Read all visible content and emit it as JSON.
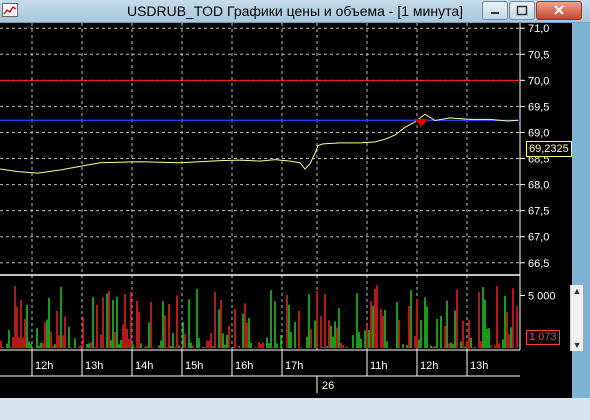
{
  "window": {
    "title": "USDRUB_TOD Графики цены и объема - [1 минута]",
    "icon": "chart-window-icon",
    "controls": [
      "minimize-icon",
      "maximize-icon",
      "close-icon"
    ]
  },
  "price_chart": {
    "y_ticks": [
      "71,0",
      "70,5",
      "70,0",
      "69,5",
      "69,0",
      "68,5",
      "68,0",
      "67,5",
      "67,0",
      "66,5"
    ],
    "last_price": "69,2325",
    "line_color": "#ffff99",
    "red_level_color": "#ff2020",
    "blue_level_color": "#1f3fff"
  },
  "volume_chart": {
    "y_ticks": [
      "5 000"
    ],
    "last_volume": "1 073",
    "up_color": "#20c020",
    "down_color": "#e02020"
  },
  "time_axis": {
    "labels": [
      "12h",
      "13h",
      "14h",
      "15h",
      "16h",
      "17h",
      "11h",
      "12h",
      "13h"
    ],
    "day_label": "26"
  },
  "chart_data": {
    "type": "line",
    "title": "USDRUB_TOD Графики цены и объема - [1 минута]",
    "x_ticks": [
      "12h",
      "13h",
      "14h",
      "15h",
      "16h",
      "17h",
      "11h",
      "12h",
      "13h"
    ],
    "ylim": [
      66.4,
      71.1
    ],
    "series": [
      {
        "values": [
          [
            0,
            68.3
          ],
          [
            18,
            68.25
          ],
          [
            38,
            68.22
          ],
          [
            60,
            68.28
          ],
          [
            80,
            68.35
          ],
          [
            100,
            68.42
          ],
          [
            120,
            68.43
          ],
          [
            140,
            68.44
          ],
          [
            160,
            68.43
          ],
          [
            180,
            68.42
          ],
          [
            200,
            68.44
          ],
          [
            220,
            68.46
          ],
          [
            240,
            68.47
          ],
          [
            260,
            68.45
          ],
          [
            275,
            68.48
          ],
          [
            290,
            68.45
          ],
          [
            300,
            68.42
          ],
          [
            305,
            68.3
          ],
          [
            310,
            68.4
          ],
          [
            315,
            68.6
          ],
          [
            318,
            68.75
          ],
          [
            323,
            68.78
          ],
          [
            340,
            68.8
          ],
          [
            360,
            68.8
          ],
          [
            375,
            68.82
          ],
          [
            385,
            68.87
          ],
          [
            395,
            68.95
          ],
          [
            405,
            69.1
          ],
          [
            415,
            69.2
          ],
          [
            425,
            69.35
          ],
          [
            435,
            69.23
          ],
          [
            450,
            69.28
          ],
          [
            470,
            69.25
          ],
          [
            490,
            69.25
          ],
          [
            508,
            69.22
          ],
          [
            518,
            69.2325
          ]
        ]
      }
    ],
    "reference_lines": [
      70.0,
      69.2325
    ],
    "volume_ylim": [
      0,
      6000
    ],
    "last_volume": 1073
  }
}
